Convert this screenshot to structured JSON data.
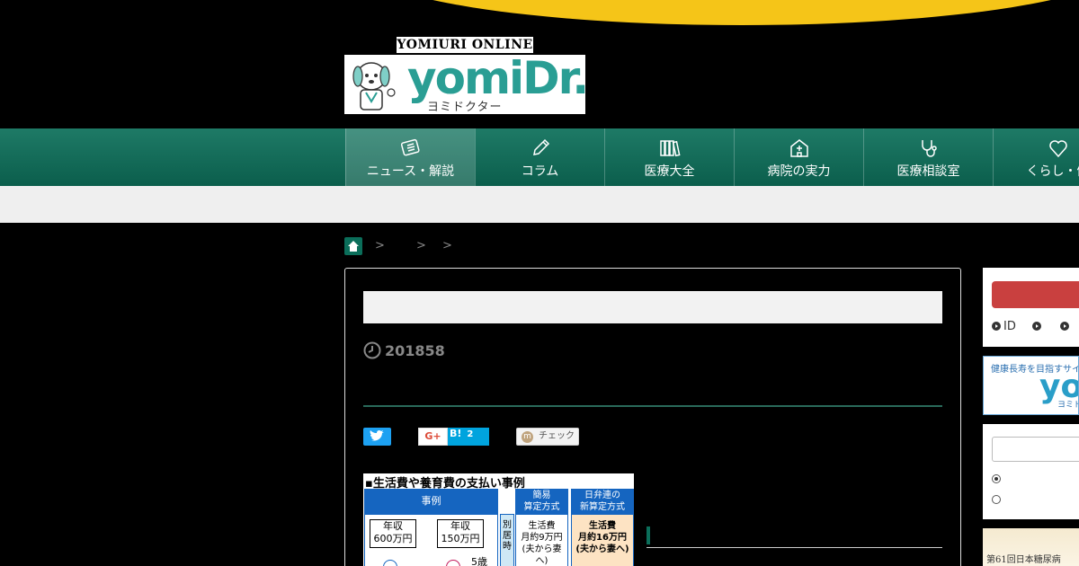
{
  "logo": {
    "top_text": "YOMIURI ONLINE",
    "word": "yomiDr.",
    "sub": "ヨミドクター"
  },
  "nav": {
    "items": [
      {
        "label": "ニュース・解説",
        "icon": "news-icon"
      },
      {
        "label": "コラム",
        "icon": "pen-icon"
      },
      {
        "label": "医療大全",
        "icon": "books-icon"
      },
      {
        "label": "病院の実力",
        "icon": "hospital-icon"
      },
      {
        "label": "医療相談室",
        "icon": "stethoscope-icon"
      },
      {
        "label": "くらし・健",
        "icon": "heart-icon"
      }
    ]
  },
  "breadcrumb": {
    "separators": [
      ">",
      ">",
      ">"
    ]
  },
  "article": {
    "date": "201858",
    "share": {
      "gplus": "G+",
      "hatena": "B!",
      "hatena_count": "2",
      "mixi_label": "チェック",
      "mixi_mark": "m"
    },
    "figure": {
      "title": "生活費や養育費の支払い事例",
      "col1": "事例",
      "col2": "簡易\n算定方式",
      "col3": "日弁連の\n新算定方式",
      "box1": "年収\n600万円",
      "box2": "年収\n150万円",
      "age": "5歳",
      "side": "別\n居\n時",
      "c2": "生活費\n月約9万円\n(夫から妻へ)",
      "c3": "生活費\n月約16万円\n(夫から妻へ)"
    }
  },
  "sidebar": {
    "login_links": [
      "ID",
      "",
      ""
    ],
    "banner_text": "健康長寿を目指すサイト",
    "banner_logo": "yo",
    "banner_sub": "ヨミド",
    "ad_text": "第61回日本糖尿病"
  },
  "colors": {
    "nav_green": "#0b6e5a",
    "accent_yellow": "#f5c518",
    "login_red": "#c9403f"
  }
}
